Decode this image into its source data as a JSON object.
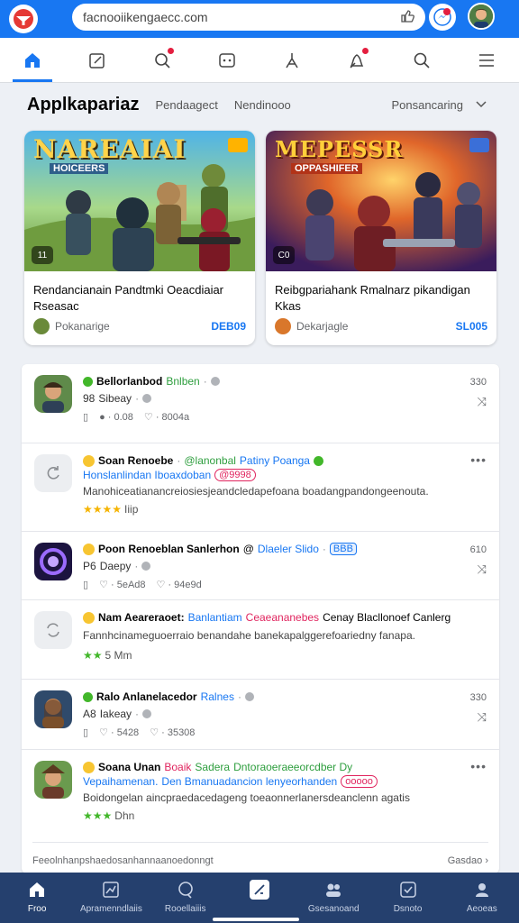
{
  "browser": {
    "url": "facnooiikengaecc.com"
  },
  "nav": {
    "items": [
      {
        "name": "home",
        "icon": "home-icon"
      },
      {
        "name": "notes",
        "icon": "edit-icon"
      },
      {
        "name": "search-alerts",
        "icon": "search-badge-icon"
      },
      {
        "name": "gaming",
        "icon": "gamepad-icon"
      },
      {
        "name": "tools",
        "icon": "compass-icon"
      },
      {
        "name": "alerts",
        "icon": "notification-icon"
      },
      {
        "name": "search",
        "icon": "search-icon"
      },
      {
        "name": "menu",
        "icon": "menu-icon"
      }
    ]
  },
  "filter": {
    "title": "Applkapariaz",
    "tab1": "Pendaagect",
    "tab2": "Nendinooo",
    "sort": "Ponsancaring"
  },
  "cards": [
    {
      "game_title": "NAREAIAI",
      "game_subtitle": "HOICEERS",
      "badge": "11",
      "title": "Rendancianain Pandtmki Oeacdiaiar Rseasac",
      "author": "Pokanarige",
      "count": "DEB09",
      "accent": "#1877f2"
    },
    {
      "game_title": "MEPESSR",
      "game_subtitle": "OPPASHIFER",
      "badge": "C0",
      "title": "Reibgpariahank Rmalnarz pikandigan Kkas",
      "author": "Dekarjagle",
      "count": "SL005",
      "accent": "#1877f2"
    }
  ],
  "feed": {
    "rows": [
      {
        "name": "Bellorlanbod",
        "tag": "Bnlben",
        "sub": "Sibeay",
        "sub_prefix": "98",
        "stat1": "0.08",
        "stat2": "8004a",
        "side_top": "330",
        "side_icon": "share-icon"
      },
      {
        "name": "Soan Renoebe",
        "tag": "@lanonbal",
        "tag2": "Patiny Poanga",
        "line2a": "Honslanlindan Iboaxdoban",
        "line2pill": "@9998",
        "text": "Manohiceatianancreiosiesjeandcledapefoana boadangpandongeenouta.",
        "rating": "★★★★",
        "rating_text": "Iiip"
      },
      {
        "name": "Poon Renoeblan Sanlerhon",
        "tag": "Dlaeler Slido",
        "tag_pill": "BBB",
        "sub": "Daepy",
        "sub_prefix": "P6",
        "stat1": "5eAd8",
        "stat2": "94e9d",
        "side_top": "610",
        "side_icon": "share-icon"
      },
      {
        "name": "Nam Aeareraoet:",
        "tag": "Banlantiam",
        "tag2": "Ceaeananebes",
        "tag3": "Cenay Blacllonoef Canlerg",
        "text": "Fannhcinameguoerraio benandahe banekapalggerefoariedny fanapa.",
        "rating": "★★",
        "rating_text": "5 Mm"
      },
      {
        "name": "Ralo Anlanelacedor",
        "tag": "Ralnes",
        "sub": "Iakeay",
        "sub_prefix": "A8",
        "stat1": "5428",
        "stat2": "35308",
        "side_top": "330",
        "side_icon": "share-icon"
      },
      {
        "name": "Soana Unan",
        "tag": "Boaik",
        "tag2": "Sadera",
        "tag3": "Dntoraoeraeeorcdber Dy",
        "line2a": "Vepaihamenan.",
        "line2b": "Den Bmanuadancion lenyeorhanden",
        "line2pill": "ooooo",
        "text": "Boidongelan aincpraedacedageng toeaonnerlanersdeanclenn agatis",
        "rating": "★★★",
        "rating_text": "Dhn"
      }
    ],
    "footer_left": "Feeolnhanpshaedosanhannaanoedonngt",
    "footer_right": "Gasdao"
  },
  "tabbar": {
    "items": [
      {
        "label": "Froo",
        "icon": "home-icon"
      },
      {
        "label": "Apramenndlaiis",
        "icon": "chart-icon"
      },
      {
        "label": "Rooellaiiis",
        "icon": "chat-icon"
      },
      {
        "label": "",
        "icon": "create-icon"
      },
      {
        "label": "Gsesanoand",
        "icon": "groups-icon"
      },
      {
        "label": "Dsnoto",
        "icon": "check-icon"
      },
      {
        "label": "Aeoeas",
        "icon": "profile-icon"
      }
    ]
  }
}
